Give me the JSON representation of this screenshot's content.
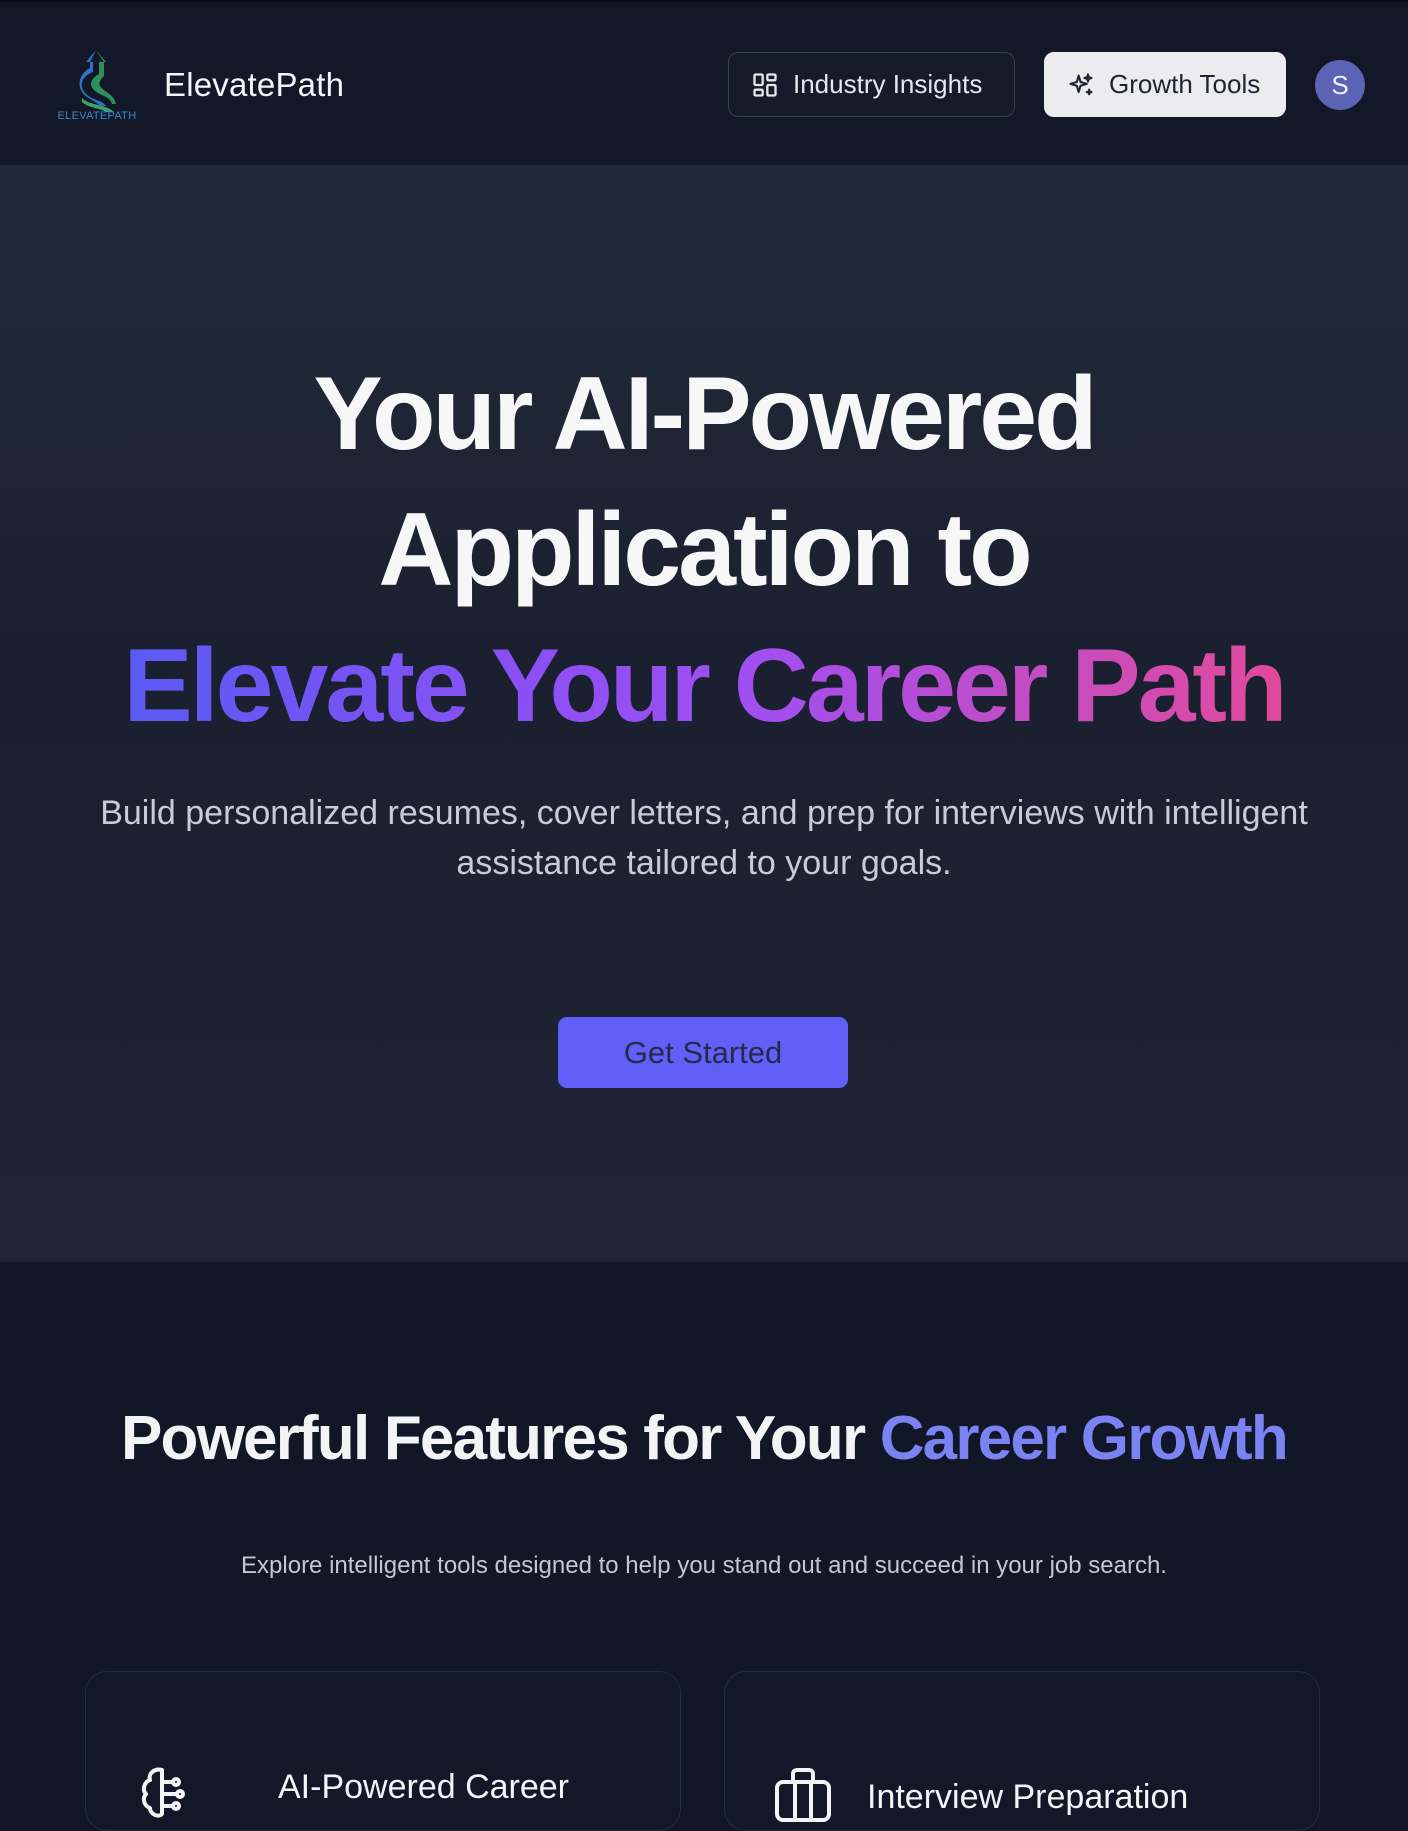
{
  "header": {
    "brand": "ElevatePath",
    "logo_text": "ELEVATEPATH",
    "nav": [
      {
        "label": "Industry Insights",
        "icon": "dashboard-grid-icon"
      },
      {
        "label": "Growth Tools",
        "icon": "sparkles-icon"
      }
    ],
    "avatar_initial": "S"
  },
  "hero": {
    "line1": "Your AI-Powered",
    "line2": "Application to",
    "line3": "Elevate Your Career Path",
    "subtitle": "Build personalized resumes, cover letters, and prep for interviews with intelligent assistance tailored to your goals.",
    "cta": "Get Started"
  },
  "features": {
    "title_main": "Powerful Features for Your ",
    "title_accent": "Career Growth",
    "subtitle": "Explore intelligent tools designed to help you stand out and succeed in your job search.",
    "cards": [
      {
        "title": "AI-Powered Career",
        "icon": "brain-icon"
      },
      {
        "title": "Interview Preparation",
        "icon": "briefcase-icon"
      }
    ]
  },
  "colors": {
    "background": "#111726",
    "accent": "#6060f8",
    "accent_text": "#7b82f2",
    "gradient_start": "#5b5bf5",
    "gradient_end": "#e24a9b"
  }
}
